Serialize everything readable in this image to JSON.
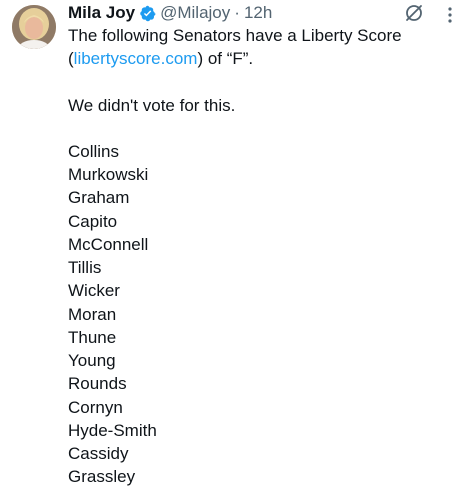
{
  "author": {
    "name": "Mila Joy",
    "handle": "@Milajoy",
    "separator": "·",
    "time": "12h",
    "verified": true
  },
  "icons": {
    "verified": "verified-badge-icon",
    "grok": "grok-icon",
    "more": "more-options-icon"
  },
  "colors": {
    "link": "#1d9bf0",
    "secondary_text": "#536471",
    "primary_text": "#0f1419"
  },
  "tweet": {
    "line1_pre": "The following Senators have a Liberty Score (",
    "link_text": "libertyscore.com",
    "line1_post": ") of “F”.",
    "statement": "We didn't vote for this.",
    "senators": [
      "Collins",
      "Murkowski",
      "Graham",
      "Capito",
      "McConnell",
      "Tillis",
      "Wicker",
      "Moran",
      "Thune",
      "Young",
      "Rounds",
      "Cornyn",
      "Hyde-Smith",
      "Cassidy",
      "Grassley"
    ]
  }
}
